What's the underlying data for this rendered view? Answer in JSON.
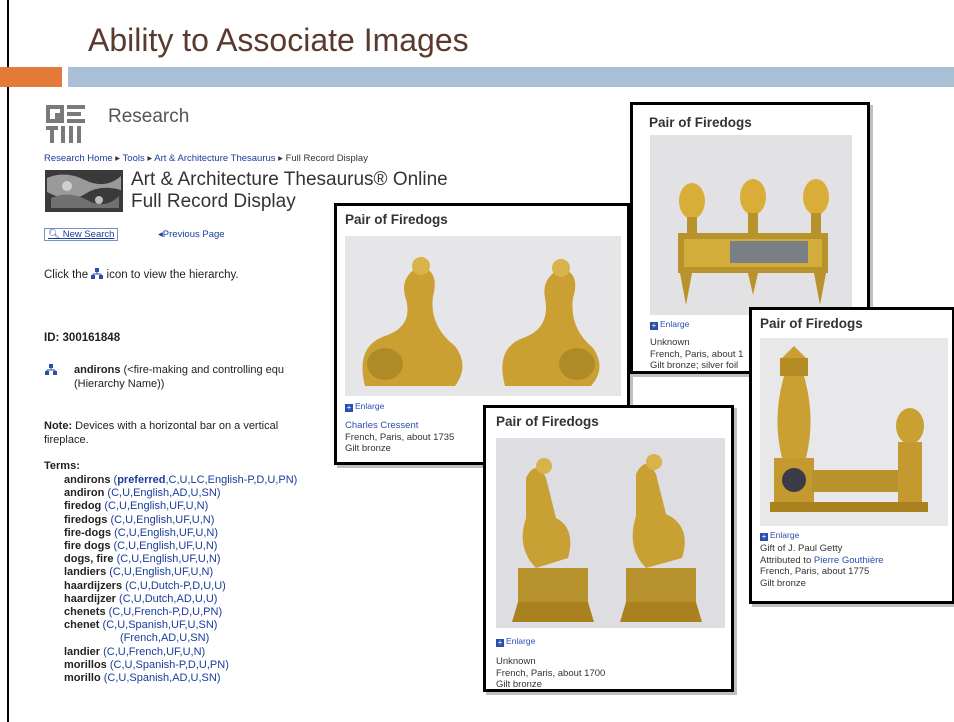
{
  "slide": {
    "title": "Ability to Associate Images",
    "colors": {
      "orange": "#e37a3a",
      "blue": "#a9bfd6",
      "title": "#5a3a2e"
    }
  },
  "getty": {
    "logo_icon": "getty-logo-icon",
    "research": "Research",
    "breadcrumb": [
      "Research Home",
      "Tools",
      "Art & Architecture Thesaurus",
      "Full Record Display"
    ],
    "aat_line1": "Art & Architecture Thesaurus® Online",
    "aat_line2": "Full Record Display",
    "new_search": "New Search",
    "prev_page": "Previous Page",
    "hint_before": "Click the",
    "hint_after": "icon to view the hierarchy.",
    "id_label": "ID: 300161848",
    "andirons_term": "andirons",
    "andirons_rest": "(<fire-making and controlling equ",
    "andirons_line2": "(Hierarchy Name))",
    "note_label": "Note:",
    "note_text": "Devices with a horizontal bar on a vertical",
    "note_line2": "fireplace.",
    "terms_label": "Terms:",
    "terms": [
      {
        "term": "andirons",
        "pref": "preferred",
        "q": ",C,U,LC,English-P,D,U,PN)"
      },
      {
        "term": "andiron",
        "q": "(C,U,English,AD,U,SN)"
      },
      {
        "term": "firedog",
        "q": "(C,U,English,UF,U,N)"
      },
      {
        "term": "firedogs",
        "q": "(C,U,English,UF,U,N)"
      },
      {
        "term": "fire-dogs",
        "q": "(C,U,English,UF,U,N)"
      },
      {
        "term": "fire dogs",
        "q": "(C,U,English,UF,U,N)"
      },
      {
        "term": "dogs, fire",
        "q": "(C,U,English,UF,U,N)"
      },
      {
        "term": "landiers",
        "q": "(C,U,English,UF,U,N)"
      },
      {
        "term": "haardijzers",
        "q": "(C,U,Dutch-P,D,U,U)"
      },
      {
        "term": "haardijzer",
        "q": "(C,U,Dutch,AD,U,U)"
      },
      {
        "term": "chenets",
        "q": "(C,U,French-P,D,U,PN)"
      },
      {
        "term": "chenet",
        "q": "(C,U,Spanish,UF,U,SN)"
      },
      {
        "term": "",
        "q": "(French,AD,U,SN)"
      },
      {
        "term": "landier",
        "q": "(C,U,French,UF,U,N)"
      },
      {
        "term": "morillos",
        "q": "(C,U,Spanish-P,D,U,PN)"
      },
      {
        "term": "morillo",
        "q": "(C,U,Spanish,AD,U,SN)"
      }
    ]
  },
  "cards": {
    "c1": {
      "title": "Pair of Firedogs",
      "enlarge": "Enlarge",
      "maker": "Charles Cressent",
      "place": "French, Paris, about 1735",
      "material": "Gilt bronze"
    },
    "c2": {
      "title": "Pair of Firedogs",
      "enlarge": "Enlarge",
      "maker": "Unknown",
      "place": "French, Paris, about 1",
      "material": "Gilt bronze; silver foil"
    },
    "c3": {
      "title": "Pair of Firedogs",
      "enlarge": "Enlarge",
      "maker": "Unknown",
      "place": "French, Paris, about 1700",
      "material": "Gilt bronze"
    },
    "c4": {
      "title": "Pair of Firedogs",
      "enlarge": "Enlarge",
      "gift": "Gift of J. Paul Getty",
      "attrib_prefix": "Attributed to",
      "attrib_name": "Pierre Gouthière",
      "place": "French, Paris, about 1775",
      "material": "Gilt bronze"
    }
  }
}
